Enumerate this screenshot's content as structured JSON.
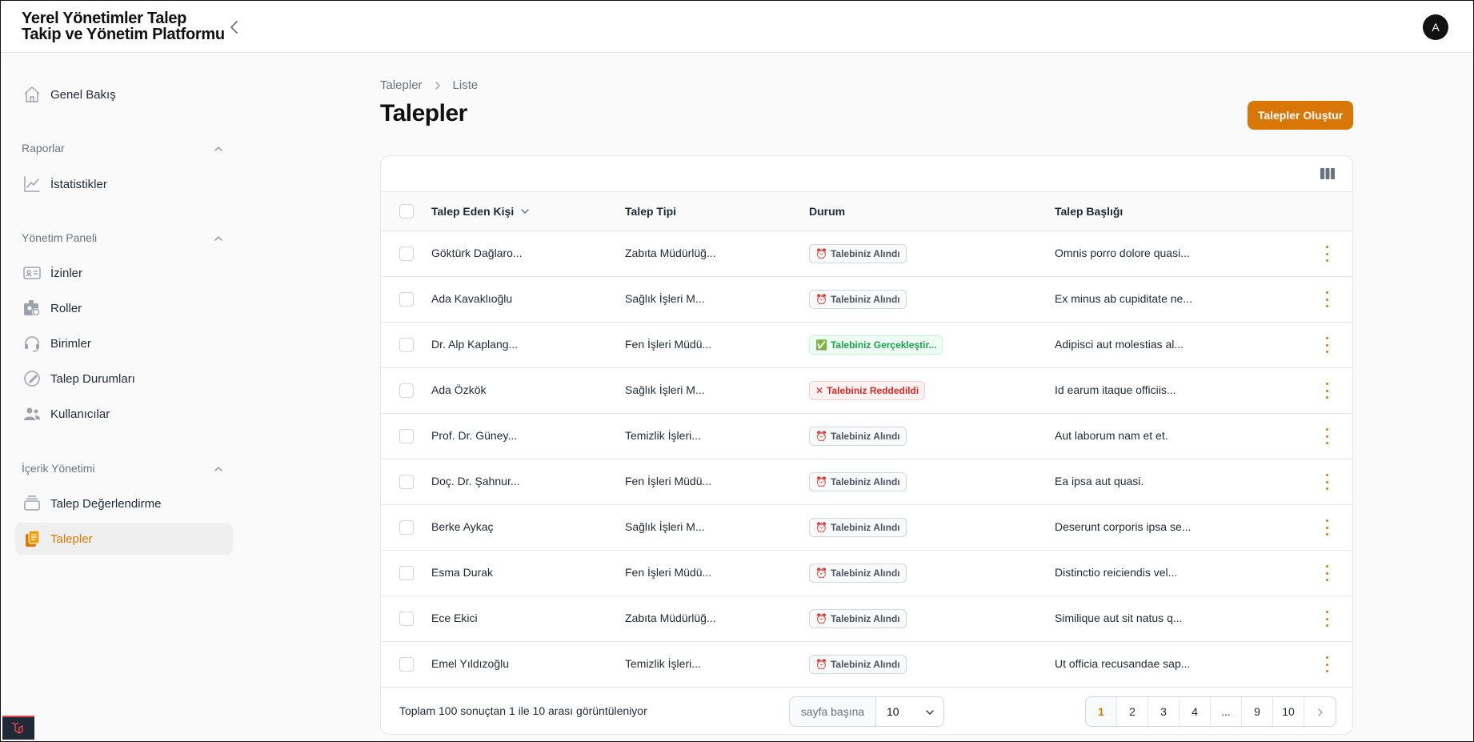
{
  "app": {
    "title_line1": "Yerel Yönetimler Talep",
    "title_line2": "Takip ve Yönetim Platformu",
    "avatar_initial": "A"
  },
  "sidebar": {
    "overview": "Genel Bakış",
    "groups": {
      "reports": {
        "label": "Raporlar",
        "items": [
          "İstatistikler"
        ]
      },
      "admin": {
        "label": "Yönetim Paneli",
        "items": [
          "İzinler",
          "Roller",
          "Birimler",
          "Talep Durumları",
          "Kullanıcılar"
        ]
      },
      "content": {
        "label": "İçerik Yönetimi",
        "items": [
          "Talep Değerlendirme",
          "Talepler"
        ]
      }
    }
  },
  "breadcrumb": [
    "Talepler",
    "Liste"
  ],
  "page_title": "Talepler",
  "create_button": "Talepler Oluştur",
  "table": {
    "columns": [
      "Talep Eden Kişi",
      "Talep Tipi",
      "Durum",
      "Talep Başlığı"
    ],
    "rows": [
      {
        "person": "Göktürk Dağlaro...",
        "type": "Zabıta Müdürlüğ...",
        "status": "Talebiniz Alındı",
        "status_kind": "received",
        "title": "Omnis porro dolore quasi..."
      },
      {
        "person": "Ada Kavaklıoğlu",
        "type": "Sağlık İşleri M...",
        "status": "Talebiniz Alındı",
        "status_kind": "received",
        "title": "Ex minus ab cupiditate ne..."
      },
      {
        "person": "Dr. Alp Kaplang...",
        "type": "Fen İşleri Müdü...",
        "status": "Talebiniz Gerçekleştir...",
        "status_kind": "success",
        "title": "Adipisci aut molestias al..."
      },
      {
        "person": "Ada Özkök",
        "type": "Sağlık İşleri M...",
        "status": "Talebiniz Reddedildi",
        "status_kind": "danger",
        "title": "Id earum itaque officiis..."
      },
      {
        "person": "Prof. Dr. Güney...",
        "type": "Temizlik İşleri...",
        "status": "Talebiniz Alındı",
        "status_kind": "received",
        "title": "Aut laborum nam et et."
      },
      {
        "person": "Doç. Dr. Şahnur...",
        "type": "Fen İşleri Müdü...",
        "status": "Talebiniz Alındı",
        "status_kind": "received",
        "title": "Ea ipsa aut quasi."
      },
      {
        "person": "Berke Aykaç",
        "type": "Sağlık İşleri M...",
        "status": "Talebiniz Alındı",
        "status_kind": "received",
        "title": "Deserunt corporis ipsa se..."
      },
      {
        "person": "Esma Durak",
        "type": "Fen İşleri Müdü...",
        "status": "Talebiniz Alındı",
        "status_kind": "received",
        "title": "Distinctio reiciendis vel..."
      },
      {
        "person": "Ece Ekici",
        "type": "Zabıta Müdürlüğ...",
        "status": "Talebiniz Alındı",
        "status_kind": "received",
        "title": "Similique aut sit natus q..."
      },
      {
        "person": "Emel Yıldızoğlu",
        "type": "Temizlik İşleri...",
        "status": "Talebiniz Alındı",
        "status_kind": "received",
        "title": "Ut officia recusandae sap..."
      }
    ]
  },
  "footer": {
    "summary": "Toplam 100 sonuçtan 1 ile 10 arası görüntüleniyor",
    "per_page_label": "sayfa başına",
    "per_page_value": "10",
    "pages": [
      "1",
      "2",
      "3",
      "4",
      "...",
      "9",
      "10"
    ],
    "current_page": "1"
  },
  "colors": {
    "accent": "#d97706",
    "success": "#16a34a",
    "danger": "#dc2626"
  }
}
